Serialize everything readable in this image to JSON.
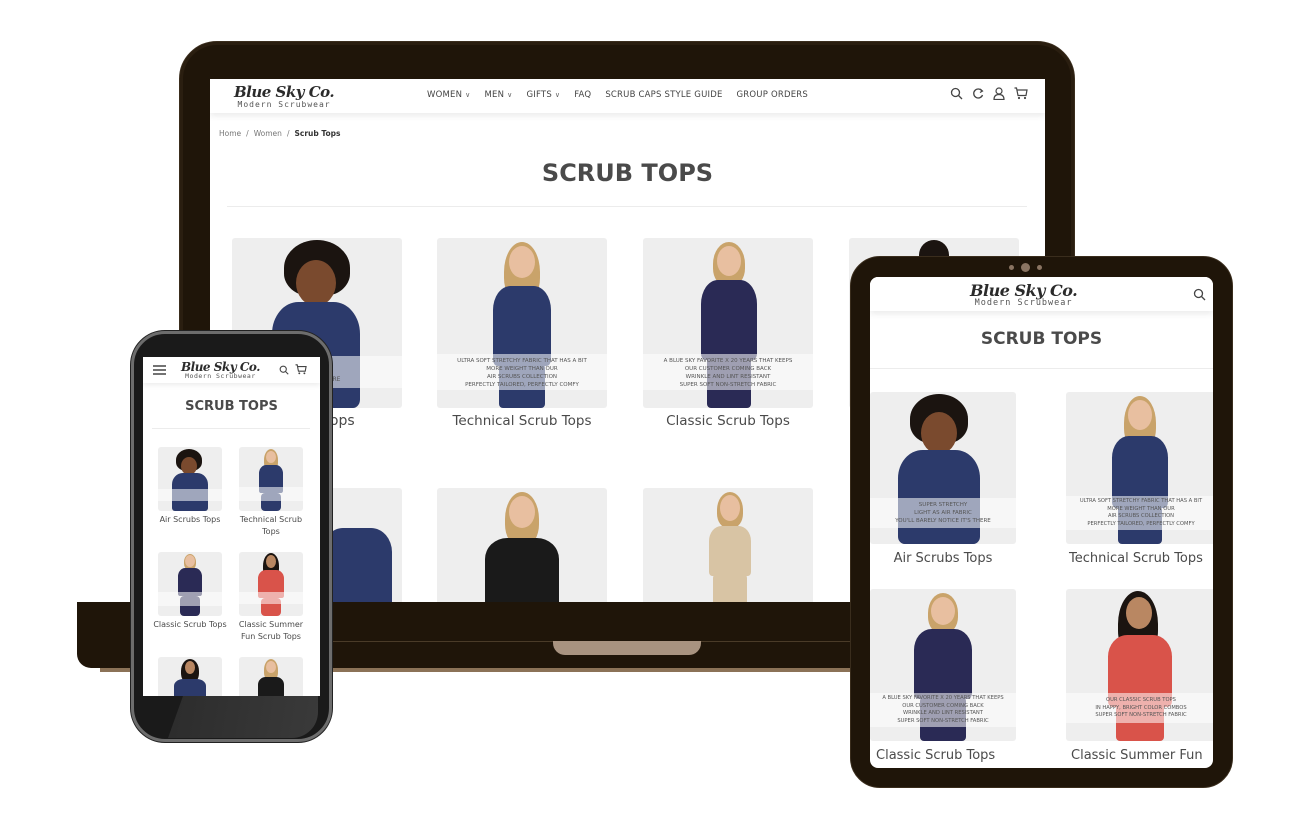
{
  "brand": {
    "logo_main": "Blue Sky Co.",
    "logo_sub": "Modern Scrubwear"
  },
  "colors": {
    "device_frame": "#1f1509",
    "page_bg": "#ffffff",
    "card_bg": "#eeeeee",
    "title_text": "#4a4a4a",
    "navy_scrub": "#2c3a6b",
    "red_scrub": "#d9534a"
  },
  "laptop": {
    "nav": [
      {
        "label": "WOMEN",
        "has_dropdown": true
      },
      {
        "label": "MEN",
        "has_dropdown": true
      },
      {
        "label": "GIFTS",
        "has_dropdown": true
      },
      {
        "label": "FAQ",
        "has_dropdown": false
      },
      {
        "label": "SCRUB CAPS STYLE GUIDE",
        "has_dropdown": false
      },
      {
        "label": "GROUP ORDERS",
        "has_dropdown": false
      }
    ],
    "header_icons": [
      "search-icon",
      "refresh-icon",
      "account-icon",
      "cart-icon"
    ],
    "breadcrumb": {
      "home": "Home",
      "separator": "/",
      "women": "Women",
      "current": "Scrub Tops"
    },
    "page_title": "SCRUB TOPS",
    "products_row1": [
      {
        "name": "Air Scrubs Tops",
        "visible_name": "s Tops",
        "caption": [
          "CHY",
          "ABRIC",
          "E IT'S THERE"
        ]
      },
      {
        "name": "Technical Scrub Tops",
        "caption": [
          "ULTRA SOFT STRETCHY FABRIC THAT HAS A BIT",
          "MORE WEIGHT THAN OUR",
          "AIR SCRUBS COLLECTION",
          "PERFECTLY TAILORED, PERFECTLY COMFY"
        ]
      },
      {
        "name": "Classic Scrub Tops",
        "caption": [
          "A BLUE SKY FAVORITE X 20 YEARS THAT KEEPS",
          "OUR CUSTOMER COMING BACK",
          "WRINKLE AND LINT RESISTANT",
          "SUPER SOFT NON-STRETCH FABRIC"
        ]
      }
    ]
  },
  "tablet": {
    "header_icons": [
      "search-icon"
    ],
    "page_title": "SCRUB TOPS",
    "products": [
      {
        "name": "Air Scrubs Tops",
        "caption": [
          "SUPER STRETCHY",
          "LIGHT AS AIR FABRIC",
          "YOU'LL BARELY NOTICE IT'S THERE"
        ]
      },
      {
        "name": "Technical Scrub Tops",
        "caption": [
          "ULTRA SOFT STRETCHY FABRIC THAT HAS A BIT",
          "MORE WEIGHT THAN OUR",
          "AIR SCRUBS COLLECTION",
          "PERFECTLY TAILORED, PERFECTLY COMFY"
        ]
      },
      {
        "name": "Classic Scrub Tops",
        "caption": [
          "A BLUE SKY FAVORITE X 20 YEARS THAT KEEPS",
          "OUR CUSTOMER COMING BACK",
          "WRINKLE AND LINT RESISTANT",
          "SUPER SOFT NON-STRETCH FABRIC"
        ]
      },
      {
        "name": "Classic Summer Fun",
        "caption": [
          "OUR CLASSIC SCRUB TOPS",
          "IN HAPPY, BRIGHT COLOR COMBOS",
          "SUPER SOFT NON-STRETCH FABRIC"
        ]
      }
    ]
  },
  "phone": {
    "header_icons": [
      "menu-icon",
      "search-icon",
      "cart-icon"
    ],
    "page_title": "SCRUB TOPS",
    "products": [
      {
        "name": "Air Scrubs Tops"
      },
      {
        "name": "Technical Scrub Tops"
      },
      {
        "name": "Classic Scrub Tops"
      },
      {
        "name": "Classic Summer Fun Scrub Tops"
      }
    ]
  }
}
